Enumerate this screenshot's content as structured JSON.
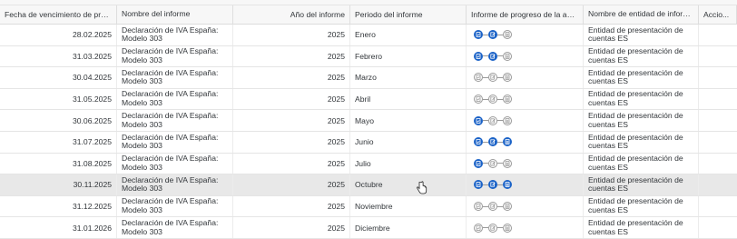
{
  "columns": [
    "Fecha de vencimiento de prese...",
    "Nombre del informe",
    "Año del informe",
    "Periodo del informe",
    "Informe de progreso de la activi...",
    "Nombre de entidad de informe",
    "Accio..."
  ],
  "rows": [
    {
      "due_date": "28.02.2025",
      "report_name": "Declaración de IVA España: Modelo 303",
      "year": "2025",
      "period": "Enero",
      "progress": [
        "active",
        "active",
        "inactive"
      ],
      "entity": "Entidad de presentación de cuentas ES"
    },
    {
      "due_date": "31.03.2025",
      "report_name": "Declaración de IVA España: Modelo 303",
      "year": "2025",
      "period": "Febrero",
      "progress": [
        "active",
        "active",
        "inactive"
      ],
      "entity": "Entidad de presentación de cuentas ES"
    },
    {
      "due_date": "30.04.2025",
      "report_name": "Declaración de IVA España: Modelo 303",
      "year": "2025",
      "period": "Marzo",
      "progress": [
        "inactive",
        "inactive",
        "inactive"
      ],
      "entity": "Entidad de presentación de cuentas ES"
    },
    {
      "due_date": "31.05.2025",
      "report_name": "Declaración de IVA España: Modelo 303",
      "year": "2025",
      "period": "Abril",
      "progress": [
        "inactive",
        "inactive",
        "inactive"
      ],
      "entity": "Entidad de presentación de cuentas ES"
    },
    {
      "due_date": "30.06.2025",
      "report_name": "Declaración de IVA España: Modelo 303",
      "year": "2025",
      "period": "Mayo",
      "progress": [
        "active",
        "inactive",
        "inactive"
      ],
      "entity": "Entidad de presentación de cuentas ES"
    },
    {
      "due_date": "31.07.2025",
      "report_name": "Declaración de IVA España: Modelo 303",
      "year": "2025",
      "period": "Junio",
      "progress": [
        "active",
        "active",
        "active"
      ],
      "entity": "Entidad de presentación de cuentas ES"
    },
    {
      "due_date": "31.08.2025",
      "report_name": "Declaración de IVA España: Modelo 303",
      "year": "2025",
      "period": "Julio",
      "progress": [
        "active",
        "inactive",
        "inactive"
      ],
      "entity": "Entidad de presentación de cuentas ES"
    },
    {
      "due_date": "30.11.2025",
      "report_name": "Declaración de IVA España: Modelo 303",
      "year": "2025",
      "period": "Octubre",
      "progress": [
        "active",
        "active",
        "active"
      ],
      "entity": "Entidad de presentación de cuentas ES",
      "hovered": true
    },
    {
      "due_date": "31.12.2025",
      "report_name": "Declaración de IVA España: Modelo 303",
      "year": "2025",
      "period": "Noviembre",
      "progress": [
        "inactive",
        "inactive",
        "inactive"
      ],
      "entity": "Entidad de presentación de cuentas ES"
    },
    {
      "due_date": "31.01.2026",
      "report_name": "Declaración de IVA España: Modelo 303",
      "year": "2025",
      "period": "Diciembre",
      "progress": [
        "inactive",
        "inactive",
        "inactive"
      ],
      "entity": "Entidad de presentación de cuentas ES"
    }
  ],
  "progress_step_icons": [
    "document-check-icon",
    "document-edit-icon",
    "document-submit-icon"
  ],
  "colors": {
    "step_active": "#1a62c7",
    "step_inactive": "#9a9a9a",
    "row_hover": "#e8e8e8"
  }
}
